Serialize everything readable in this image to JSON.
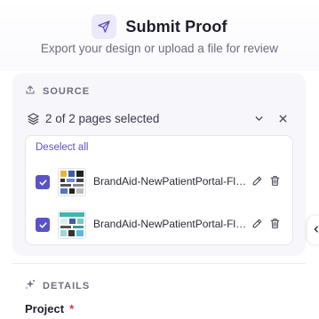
{
  "header": {
    "title": "Submit Proof",
    "subtitle": "Export your design or upload a file for review",
    "icon": "send-icon"
  },
  "source": {
    "section_label": "SOURCE",
    "icon": "upload-icon",
    "selection_text": "2 of 2 pages selected",
    "deselect_label": "Deselect all",
    "pages": [
      {
        "name": "BrandAid-NewPatientPortal-Fl…",
        "checked": true
      },
      {
        "name": "BrandAid-NewPatientPortal-Fl…",
        "checked": true
      }
    ]
  },
  "details": {
    "section_label": "DETAILS",
    "icon": "sparkle-icon",
    "project_label": "Project",
    "required_mark": "*"
  },
  "colors": {
    "accent": "#5a52c8",
    "required": "#e0304a",
    "panel": "#f7f6fa"
  }
}
